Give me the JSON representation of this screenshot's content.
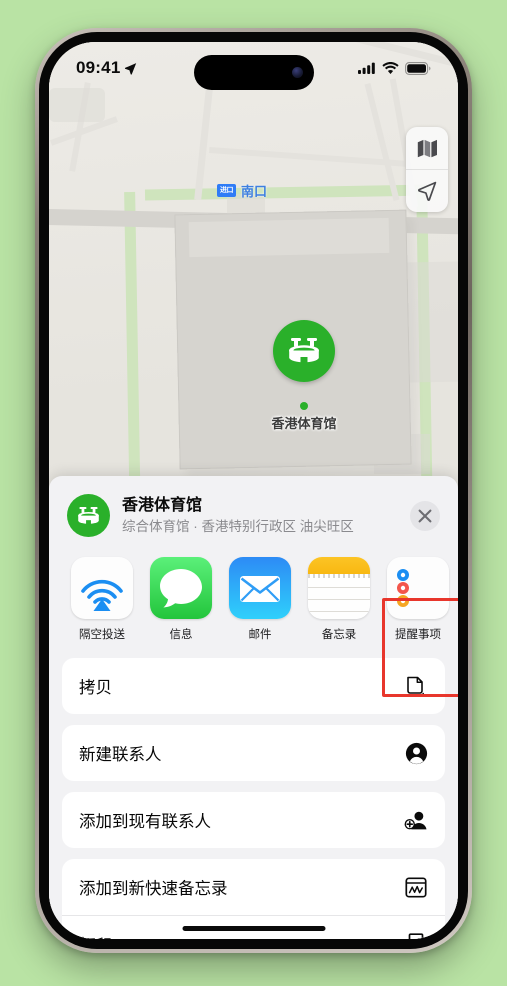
{
  "background_color": "#b9e3a4",
  "status_bar": {
    "time": "09:41",
    "location_icon": "location-arrow-icon",
    "cellular_icon": "cellular-bars-icon",
    "wifi_icon": "wifi-icon",
    "battery_icon": "battery-icon"
  },
  "map": {
    "exit_badge": "进口",
    "exit_label": "南口",
    "poi_label": "香港体育馆",
    "controls": [
      {
        "name": "map-type-button",
        "icon": "folded-map-icon"
      },
      {
        "name": "locate-me-button",
        "icon": "navigation-arrow-icon"
      }
    ]
  },
  "share_sheet": {
    "title": "香港体育馆",
    "subtitle": "综合体育馆 · 香港特别行政区 油尖旺区",
    "close_label": "✕",
    "apps": [
      {
        "label": "隔空投送",
        "icon": "airdrop-icon",
        "highlighted": false
      },
      {
        "label": "信息",
        "icon": "messages-icon",
        "highlighted": false
      },
      {
        "label": "邮件",
        "icon": "mail-icon",
        "highlighted": false
      },
      {
        "label": "备忘录",
        "icon": "notes-icon",
        "highlighted": true
      },
      {
        "label": "提醒事项",
        "icon": "reminders-icon",
        "highlighted": false
      }
    ],
    "actions": [
      {
        "label": "拷贝",
        "icon": "copy-icon"
      },
      {
        "label": "新建联系人",
        "icon": "new-contact-icon"
      },
      {
        "label": "添加到现有联系人",
        "icon": "add-to-contact-icon"
      },
      {
        "label": "添加到新快速备忘录",
        "icon": "quick-note-icon"
      },
      {
        "label": "打印",
        "icon": "printer-icon"
      }
    ]
  },
  "highlight": {
    "color": "#e8362c",
    "target": "备忘录"
  }
}
